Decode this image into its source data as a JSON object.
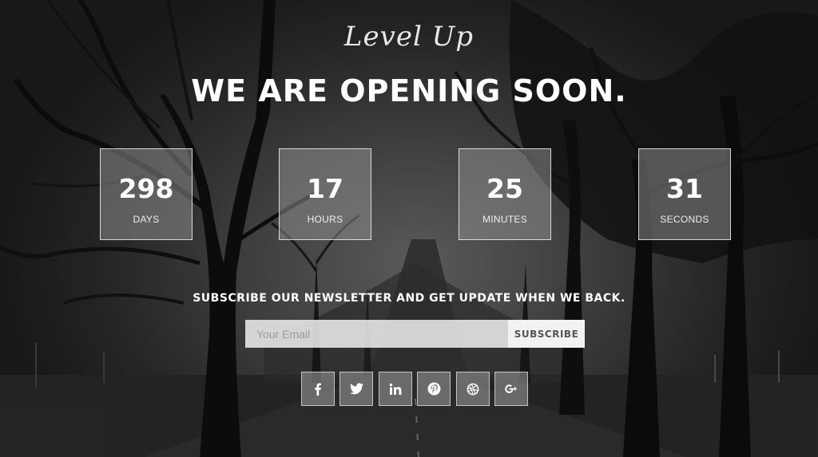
{
  "brand": {
    "name": "Level Up"
  },
  "hero": {
    "headline": "WE ARE OPENING SOON."
  },
  "countdown": [
    {
      "value": "298",
      "label": "DAYS"
    },
    {
      "value": "17",
      "label": "HOURS"
    },
    {
      "value": "25",
      "label": "MINUTES"
    },
    {
      "value": "31",
      "label": "SECONDS"
    }
  ],
  "newsletter": {
    "text": "SUBSCRIBE OUR NEWSLETTER AND GET UPDATE WHEN WE BACK.",
    "email_placeholder": "Your Email",
    "email_value": "",
    "button_label": "SUBSCRIBE"
  },
  "social": [
    {
      "name": "facebook-icon"
    },
    {
      "name": "twitter-icon"
    },
    {
      "name": "linkedin-icon"
    },
    {
      "name": "pinterest-icon"
    },
    {
      "name": "dribbble-icon"
    },
    {
      "name": "google-plus-icon"
    }
  ],
  "colors": {
    "text": "#ffffff",
    "box_fill": "#8c8c8c",
    "button_bg": "#f2f2f2",
    "button_text": "#555555"
  }
}
